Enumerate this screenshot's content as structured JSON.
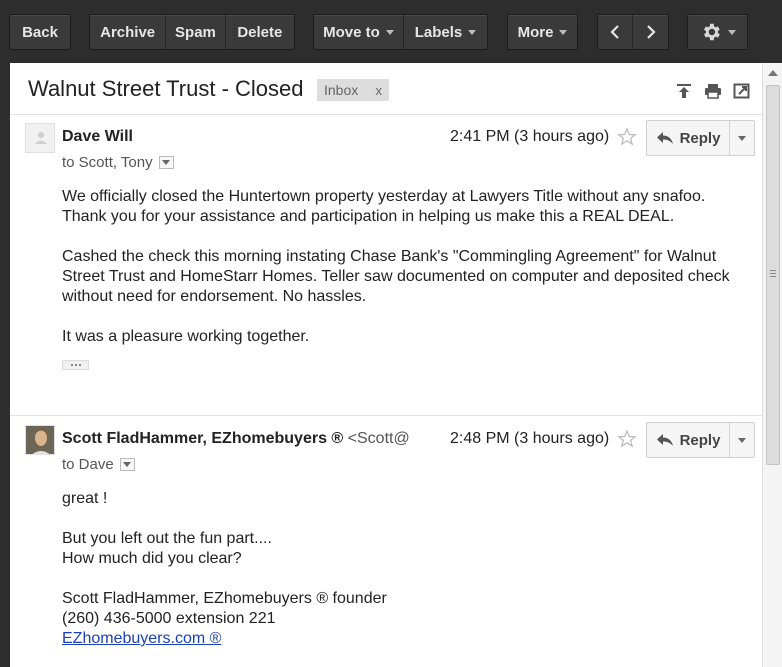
{
  "toolbar": {
    "back": "Back",
    "archive": "Archive",
    "spam": "Spam",
    "delete": "Delete",
    "move_to": "Move to",
    "labels": "Labels",
    "more": "More"
  },
  "thread": {
    "subject": "Walnut Street Trust - Closed",
    "label": "Inbox",
    "label_remove": "x"
  },
  "messages": [
    {
      "sender": "Dave Will",
      "email": "",
      "recipients": "to Scott, Tony",
      "time": "2:41 PM (3 hours ago)",
      "reply_label": "Reply",
      "body": [
        "We officially closed the Huntertown property yesterday at Lawyers Title without any snafoo.",
        "Thank you for your assistance and participation in helping us make this a REAL DEAL.",
        "",
        "Cashed the check this morning instating Chase Bank's \"Commingling Agreement\" for Walnut",
        "Street Trust and HomeStarr Homes. Teller saw documented on computer and deposited check",
        "without need for endorsement. No hassles.",
        "",
        "It was a pleasure working together."
      ]
    },
    {
      "sender": "Scott FladHammer, EZhomebuyers ®",
      "email": "<Scott@",
      "recipients": "to Dave",
      "time": "2:48 PM (3 hours ago)",
      "reply_label": "Reply",
      "body": [
        "great !",
        "",
        "But you left out the fun part....",
        "How much did you clear?",
        "",
        "Scott FladHammer, EZhomebuyers ® founder",
        "(260) 436-5000 extension 221"
      ],
      "link": "EZhomebuyers.com ®"
    }
  ]
}
